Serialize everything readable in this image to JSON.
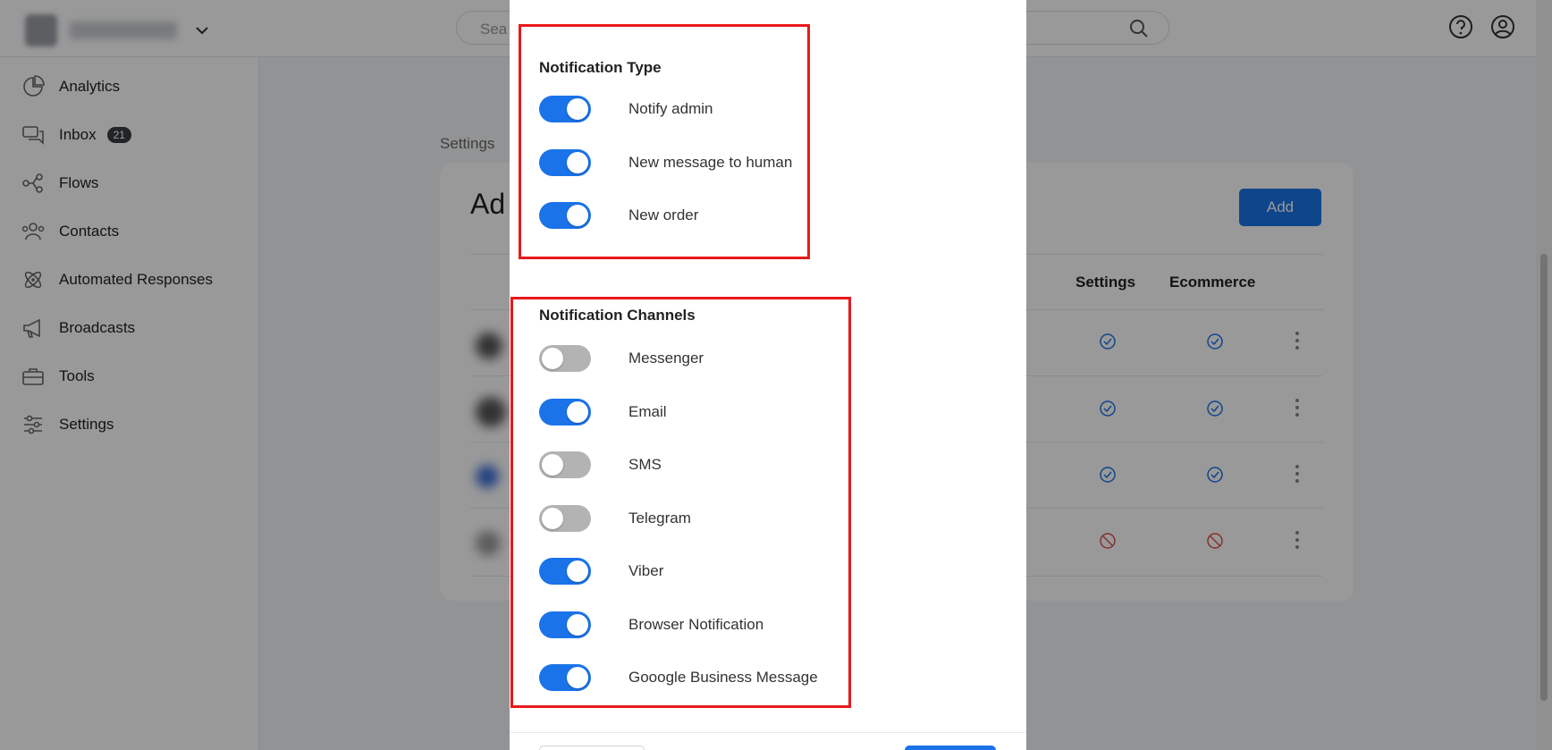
{
  "header": {
    "search_placeholder": "Sea",
    "icons": {
      "search": "search-icon",
      "help": "help-icon",
      "user": "user-icon",
      "chevron": "chevron-down-icon"
    }
  },
  "sidebar": {
    "items": [
      {
        "label": "Analytics",
        "icon": "pie-chart-icon"
      },
      {
        "label": "Inbox",
        "icon": "chat-bubbles-icon",
        "badge": "21"
      },
      {
        "label": "Flows",
        "icon": "flow-icon"
      },
      {
        "label": "Contacts",
        "icon": "contacts-icon"
      },
      {
        "label": "Automated Responses",
        "icon": "atom-icon"
      },
      {
        "label": "Broadcasts",
        "icon": "megaphone-icon"
      },
      {
        "label": "Tools",
        "icon": "toolbox-icon"
      },
      {
        "label": "Settings",
        "icon": "sliders-icon"
      }
    ]
  },
  "page": {
    "breadcrumb": "Settings",
    "title_partial": "Ad",
    "add_label": "Add",
    "columns": [
      "Settings",
      "Ecommerce"
    ],
    "rows": [
      {
        "settings": "check",
        "ecommerce": "check"
      },
      {
        "settings": "check",
        "ecommerce": "check"
      },
      {
        "settings": "check",
        "ecommerce": "check"
      },
      {
        "settings": "blocked",
        "ecommerce": "blocked"
      }
    ]
  },
  "modal": {
    "notification_type": {
      "title": "Notification Type",
      "items": [
        {
          "label": "Notify admin",
          "enabled": true
        },
        {
          "label": "New message to human",
          "enabled": true
        },
        {
          "label": "New order",
          "enabled": true
        }
      ]
    },
    "notification_channels": {
      "title": "Notification Channels",
      "items": [
        {
          "label": "Messenger",
          "enabled": false
        },
        {
          "label": "Email",
          "enabled": true
        },
        {
          "label": "SMS",
          "enabled": false
        },
        {
          "label": "Telegram",
          "enabled": false
        },
        {
          "label": "Viber",
          "enabled": true
        },
        {
          "label": "Browser Notification",
          "enabled": true
        },
        {
          "label": "Gooogle Business Message",
          "enabled": true
        }
      ]
    }
  },
  "colors": {
    "accent": "#1a73e8",
    "highlight_border": "#e8191c",
    "toggle_off": "#b3b3b3",
    "blocked": "#d9534f"
  }
}
